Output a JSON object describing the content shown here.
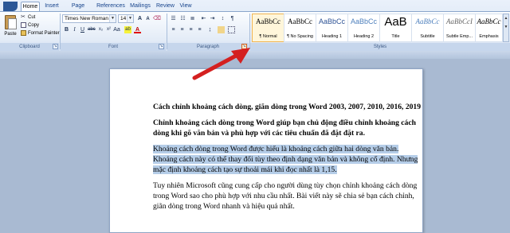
{
  "ribbon": {
    "tabs": [
      "Home",
      "Insert",
      "Page Layout",
      "References",
      "Mailings",
      "Review",
      "View"
    ],
    "active_tab": "Home",
    "clipboard": {
      "paste_label": "Paste",
      "cut_label": "Cut",
      "copy_label": "Copy",
      "format_painter_label": "Format Painter",
      "group_label": "Clipboard"
    },
    "font": {
      "font_name": "Times New Roman",
      "font_size": "14",
      "group_label": "Font"
    },
    "paragraph": {
      "group_label": "Paragraph"
    },
    "styles": {
      "group_label": "Styles",
      "items": [
        {
          "sample": "AaBbCc",
          "name": "¶ Normal"
        },
        {
          "sample": "AaBbCc",
          "name": "¶ No Spacing"
        },
        {
          "sample": "AaBbCc",
          "name": "Heading 1"
        },
        {
          "sample": "AaBbCc",
          "name": "Heading 2"
        },
        {
          "sample": "AaB",
          "name": "Title"
        },
        {
          "sample": "AaBbCc",
          "name": "Subtitle"
        },
        {
          "sample": "AaBbCcI",
          "name": "Subtle Emp..."
        },
        {
          "sample": "AaBbCc",
          "name": "Emphasis"
        }
      ]
    }
  },
  "document": {
    "title": "Cách chỉnh khoảng cách dòng, giãn dòng trong Word 2003, 2007, 2010, 2016, 2019",
    "lead": "Chỉnh khoảng cách dòng trong Word giúp bạn chủ động điều chỉnh khoảng cách dòng khi gõ văn bản và phù hợp với các tiêu chuẩn đã đặt đặt ra.",
    "highlight": "Khoảng cách dòng trong Word được hiểu là khoảng cách giữa hai dòng văn bản. Khoảng cách này có thể thay đổi tùy theo định dạng văn bản và không cố định. Nhưng mặc định khoảng cách tạo sự thoải mái khi đọc nhất là 1,15.",
    "body": "Tuy nhiên Microsoft cũng cung cấp cho người dùng tùy chọn chỉnh khoảng cách dòng trong Word sao cho phù hợp với nhu cầu nhất. Bài viết này sẽ chia sẻ bạn cách chỉnh, giãn dòng trong Word nhanh và hiệu quả nhất."
  },
  "colors": {
    "arrow": "#d42020",
    "highlight": "#b5cde8",
    "ribbon_text": "#15428b"
  }
}
